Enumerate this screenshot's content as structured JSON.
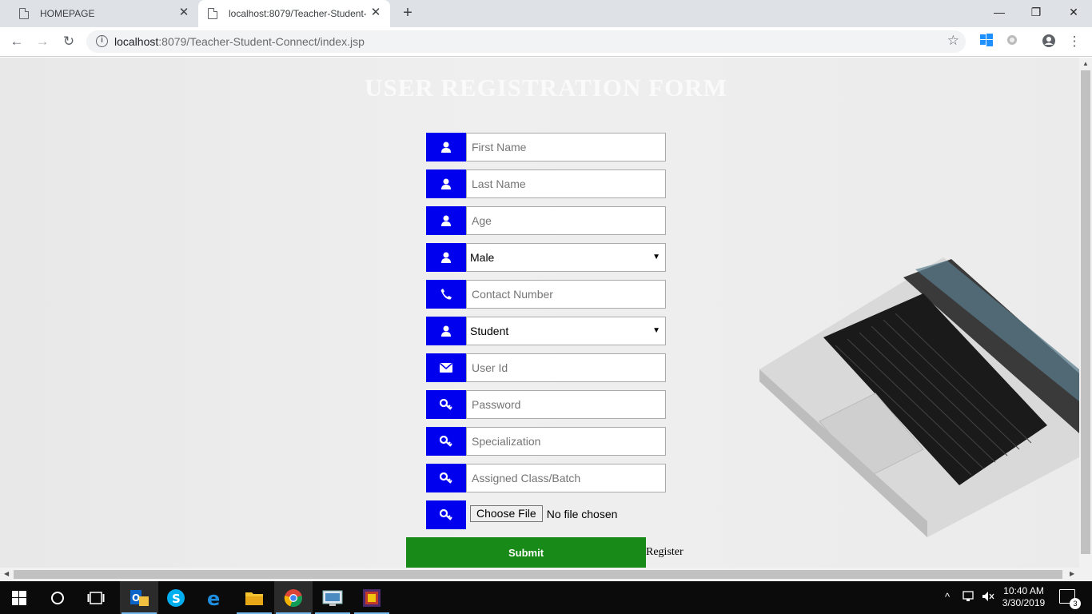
{
  "browser": {
    "tabs": [
      {
        "title": "HOMEPAGE",
        "active": false
      },
      {
        "title": "localhost:8079/Teacher-Student-C",
        "active": true
      }
    ],
    "url_host": "localhost",
    "url_rest": ":8079/Teacher-Student-Connect/index.jsp"
  },
  "page": {
    "title": "USER REGISTRATION FORM",
    "fields": [
      {
        "icon": "user-icon",
        "type": "text",
        "placeholder": "First Name"
      },
      {
        "icon": "user-icon",
        "type": "text",
        "placeholder": "Last Name"
      },
      {
        "icon": "user-icon",
        "type": "text",
        "placeholder": "Age"
      },
      {
        "icon": "user-icon",
        "type": "select",
        "value": "Male"
      },
      {
        "icon": "phone-icon",
        "type": "text",
        "placeholder": "Contact Number"
      },
      {
        "icon": "user-icon",
        "type": "select",
        "value": "Student"
      },
      {
        "icon": "envelope-icon",
        "type": "text",
        "placeholder": "User Id"
      },
      {
        "icon": "key-icon",
        "type": "password",
        "placeholder": "Password"
      },
      {
        "icon": "key-icon",
        "type": "text",
        "placeholder": "Specialization"
      },
      {
        "icon": "key-icon",
        "type": "text",
        "placeholder": "Assigned Class/Batch"
      }
    ],
    "file": {
      "icon": "key-icon",
      "button": "Choose File",
      "status": "No file chosen"
    },
    "submit_label": "Submit",
    "register_link": "Register"
  },
  "taskbar": {
    "time": "10:40 AM",
    "date": "3/30/2019",
    "notifications": "3"
  },
  "colors": {
    "icon_bg": "#0000ee",
    "submit_bg": "#178a17",
    "title_color": "#fafafa"
  }
}
